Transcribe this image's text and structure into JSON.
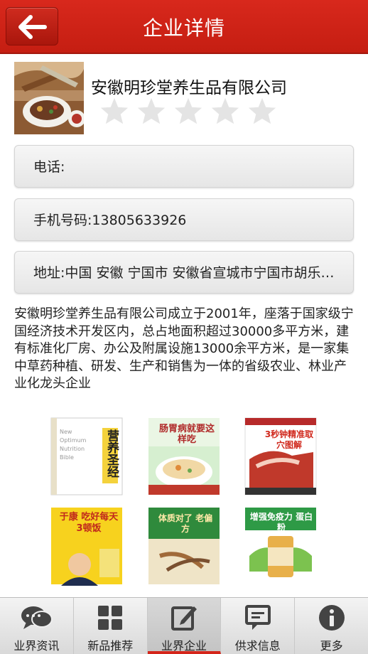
{
  "header": {
    "title": "企业详情",
    "back_icon": "arrow-left-icon"
  },
  "company": {
    "name": "安徽明珍堂养生品有限公司",
    "rating": 0,
    "rating_max": 5
  },
  "info": {
    "phone": "电话:",
    "mobile": "手机号码:13805633926",
    "address": "地址:中国 安徽 宁国市 安徽省宣城市宁国市胡乐…"
  },
  "description": "安徽明珍堂养生品有限公司成立于2001年，座落于国家级宁国经济技术开发区内，总占地面积超过30000多平方米，建有标准化厂房、办公及附属设施13000余平方米，是一家集中草药种植、研发、生产和销售为一体的省级农业、林业产业化龙头企业",
  "products": [
    {
      "title": "营养圣经",
      "subtitle": "New Optimum Nutrition Bible"
    },
    {
      "title": "肠胃病就要这样吃"
    },
    {
      "title": "3秒钟精准取穴图解"
    },
    {
      "title": "于康 吃好每天3顿饭"
    },
    {
      "title": "体质对了 老偏方"
    },
    {
      "title": "增强免疫力 蛋白粉"
    }
  ],
  "tabs": [
    {
      "label": "业界资讯",
      "icon": "chat-bubbles-icon"
    },
    {
      "label": "新品推荐",
      "icon": "grid-icon"
    },
    {
      "label": "业界企业",
      "icon": "edit-icon",
      "active": true
    },
    {
      "label": "供求信息",
      "icon": "message-box-icon"
    },
    {
      "label": "更多",
      "icon": "info-icon"
    }
  ],
  "colors": {
    "header": "#c91f14",
    "active_tab": "#d4251a"
  }
}
